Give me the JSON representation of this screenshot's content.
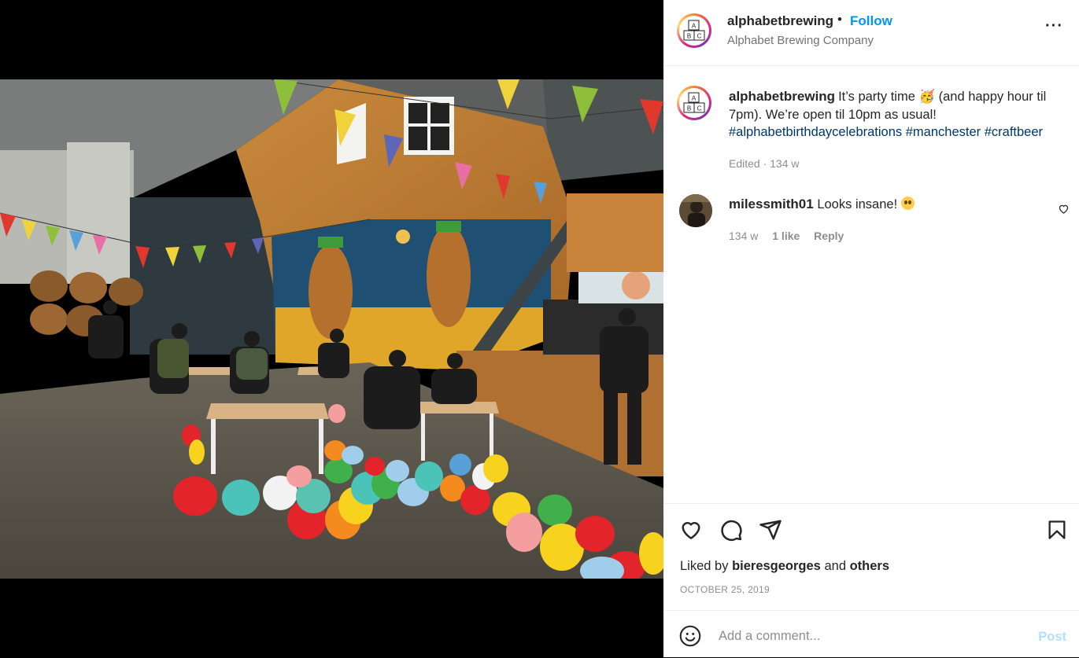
{
  "post": {
    "username": "alphabetbrewing",
    "separator": "•",
    "follow_label": "Follow",
    "location": "Alphabet Brewing Company",
    "more_label": "···",
    "caption": {
      "text": "It’s party time 🥳 (and happy hour til 7pm). We’re open til 10pm as usual!",
      "hashtags": [
        "#alphabetbirthdaycelebrations",
        "#manchester",
        "#craftbeer"
      ]
    },
    "edited_meta": "Edited · 134 w",
    "logo_letters": [
      "A",
      "B",
      "C"
    ]
  },
  "comments": [
    {
      "username": "milessmith01",
      "text": "Looks insane!",
      "emoji": "flushed-face-emoji",
      "age": "134 w",
      "likes": "1 like",
      "reply_label": "Reply"
    }
  ],
  "actions": {
    "icons": [
      "heart-icon",
      "comment-icon",
      "share-icon",
      "bookmark-icon"
    ],
    "liked_by_prefix": "Liked by",
    "liked_by_user": "bieresgeorges",
    "liked_by_and": "and",
    "liked_by_others": "others",
    "date": "OCTOBER 25, 2019"
  },
  "add_comment": {
    "placeholder": "Add a comment...",
    "post_label": "Post"
  },
  "colors": {
    "link_blue": "#0095f6",
    "hashtag": "#00376b",
    "muted": "#8e8e8e",
    "post_disabled": "#b2dffc"
  }
}
